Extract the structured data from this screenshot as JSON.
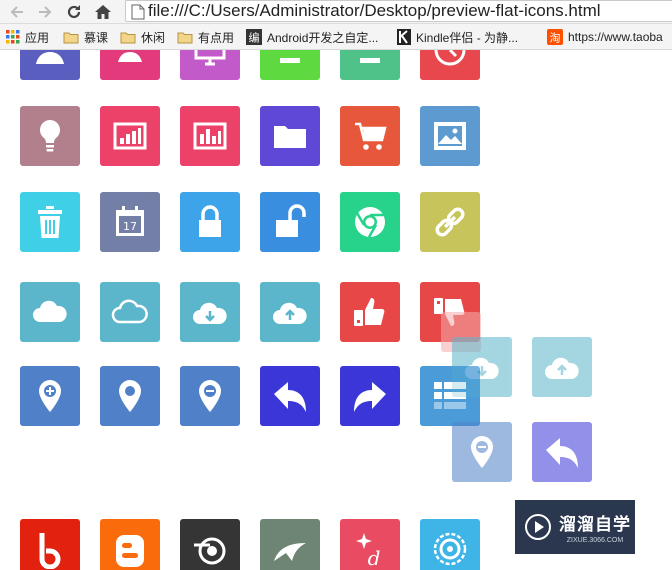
{
  "address_bar": {
    "url": "file:///C:/Users/Administrator/Desktop/preview-flat-icons.html"
  },
  "bookmarks": [
    {
      "label": "应用",
      "icon": "apps-grid-icon"
    },
    {
      "label": "慕课",
      "icon": "folder-icon"
    },
    {
      "label": "休闲",
      "icon": "folder-icon"
    },
    {
      "label": "有点用",
      "icon": "folder-icon"
    },
    {
      "label": "Android开发之自定...",
      "icon": "site-favicon"
    },
    {
      "label": "Kindle伴侣 - 为静...",
      "icon": "kindle-favicon"
    },
    {
      "label": "https://www.taoba",
      "icon": "taobao-favicon"
    }
  ],
  "icons": [
    {
      "name": "user-icon",
      "color": "#5a5fbf"
    },
    {
      "name": "user-card-icon",
      "color": "#e33a7b"
    },
    {
      "name": "monitor-icon",
      "color": "#c35ac9"
    },
    {
      "name": "green-tile-icon",
      "color": "#5fd940"
    },
    {
      "name": "teal-tile-icon",
      "color": "#4fc28a"
    },
    {
      "name": "clock-icon",
      "color": "#e8474d"
    },
    {
      "name": "lightbulb-icon",
      "color": "#b27f8c"
    },
    {
      "name": "bar-chart-icon",
      "color": "#ec4169"
    },
    {
      "name": "bar-chart-alt-icon",
      "color": "#ec4169"
    },
    {
      "name": "folder-icon",
      "color": "#6048d6"
    },
    {
      "name": "shopping-cart-icon",
      "color": "#e7573b"
    },
    {
      "name": "image-icon",
      "color": "#5d9ad0"
    },
    {
      "name": "trash-icon",
      "color": "#3fd0e8"
    },
    {
      "name": "calendar-icon",
      "color": "#737fa6"
    },
    {
      "name": "lock-icon",
      "color": "#3ea4ea"
    },
    {
      "name": "unlock-icon",
      "color": "#3a8ee0"
    },
    {
      "name": "chrome-icon",
      "color": "#27d28a"
    },
    {
      "name": "link-icon",
      "color": "#c6c45a"
    },
    {
      "name": "cloud-icon",
      "color": "#5bb6cc"
    },
    {
      "name": "cloud-outline-icon",
      "color": "#5bb6cc"
    },
    {
      "name": "cloud-download-icon",
      "color": "#5bb6cc"
    },
    {
      "name": "cloud-upload-icon",
      "color": "#5bb6cc"
    },
    {
      "name": "thumbs-up-icon",
      "color": "#e84747"
    },
    {
      "name": "thumbs-down-icon",
      "color": "#e84747"
    },
    {
      "name": "location-add-icon",
      "color": "#4f80c8"
    },
    {
      "name": "location-icon",
      "color": "#4f80c8"
    },
    {
      "name": "location-remove-icon",
      "color": "#4f80c8"
    },
    {
      "name": "reply-icon",
      "color": "#3b36d8"
    },
    {
      "name": "forward-icon",
      "color": "#3b36d8"
    },
    {
      "name": "list-icon",
      "color": "#4a9bd8"
    },
    {
      "name": "bebo-icon",
      "color": "#e2220f"
    },
    {
      "name": "blogger-icon",
      "color": "#fa6b0c"
    },
    {
      "name": "digg-icon",
      "color": "#353535"
    },
    {
      "name": "deviantart-icon",
      "color": "#6f8573"
    },
    {
      "name": "dribbble-sparkle-icon",
      "color": "#e94b62"
    },
    {
      "name": "target-icon",
      "color": "#3fb4e6"
    },
    {
      "name": "cloud-download-drag-icon",
      "color": "#5bb6cc"
    },
    {
      "name": "cloud-upload-drag-icon",
      "color": "#5bb6cc"
    },
    {
      "name": "location-remove-drag-icon",
      "color": "#4f80c8"
    },
    {
      "name": "reply-drag-icon",
      "color": "#3b36d8"
    },
    {
      "name": "thumbs-down-drag-icon",
      "color": "#e84747"
    },
    {
      "name": "list-drag-icon",
      "color": "#4a9bd8"
    }
  ],
  "watermark": {
    "title": "溜溜自学",
    "subtitle": "ZIXUE.3066.COM"
  }
}
